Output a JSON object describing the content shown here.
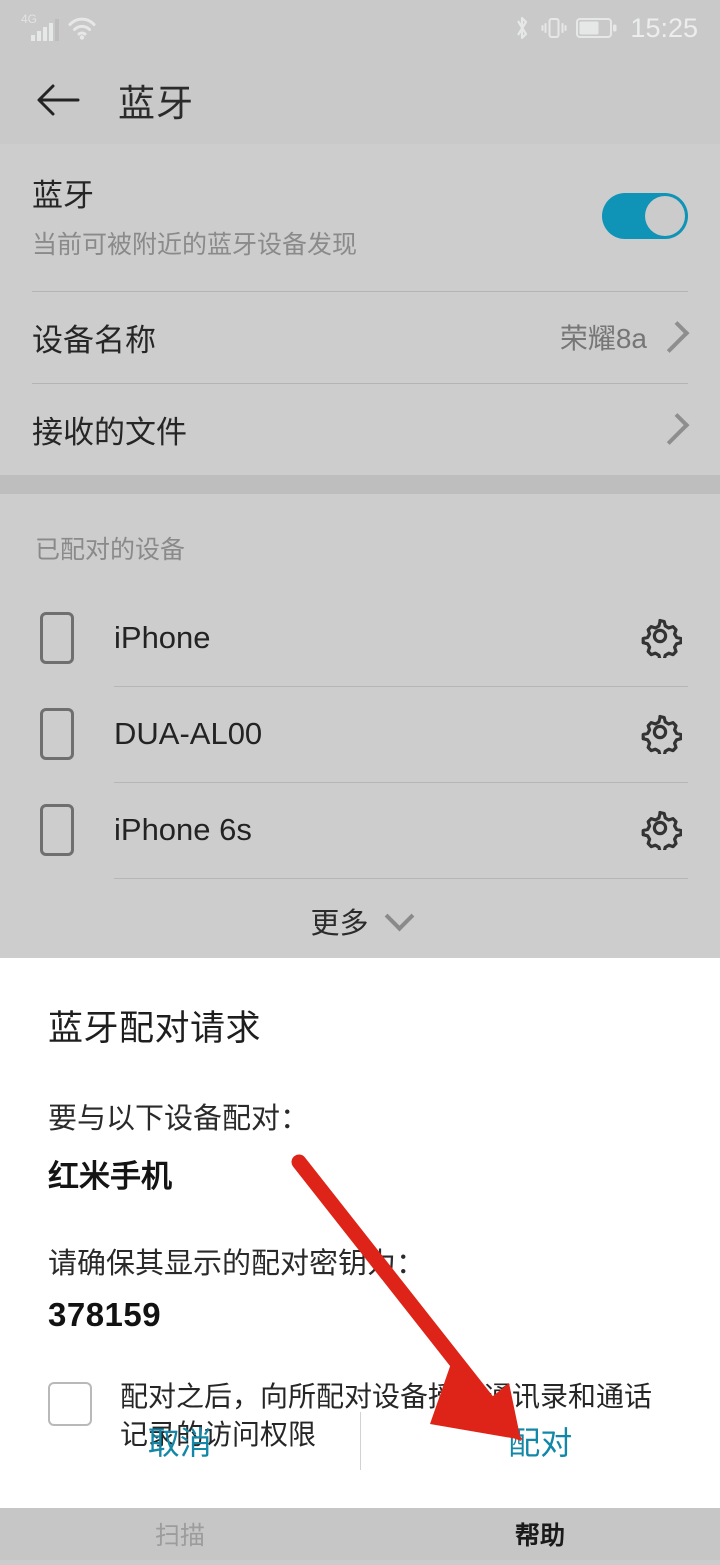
{
  "statusbar": {
    "network_label": "4G",
    "time": "15:25",
    "icons": [
      "signal-icon",
      "wifi-icon",
      "bluetooth-icon",
      "vibrate-icon",
      "battery-icon"
    ]
  },
  "header": {
    "title": "蓝牙",
    "back_icon": "back-arrow-icon"
  },
  "settings": {
    "bluetooth": {
      "label": "蓝牙",
      "sublabel": "当前可被附近的蓝牙设备发现",
      "toggle_on": true
    },
    "device_name": {
      "label": "设备名称",
      "value": "荣耀8a"
    },
    "received_files": {
      "label": "接收的文件",
      "value": ""
    }
  },
  "paired": {
    "header": "已配对的设备",
    "devices": [
      {
        "name": "iPhone"
      },
      {
        "name": "DUA-AL00"
      },
      {
        "name": "iPhone 6s"
      }
    ],
    "more_label": "更多"
  },
  "dialog": {
    "title": "蓝牙配对请求",
    "pair_with_label": "要与以下设备配对：",
    "device_name": "红米手机",
    "passkey_label": "请确保其显示的配对密钥为：",
    "passkey": "378159",
    "checkbox_label": "配对之后，向所配对设备授予通讯录和通话记录的访问权限",
    "checkbox_checked": false,
    "cancel_label": "取消",
    "pair_label": "配对"
  },
  "bottombar": {
    "scan_label": "扫描",
    "help_label": "帮助"
  },
  "colors": {
    "accent": "#1287a8",
    "toggle_on": "#0f93b6",
    "page_bg": "#cccccc",
    "annotation": "#e02020"
  }
}
